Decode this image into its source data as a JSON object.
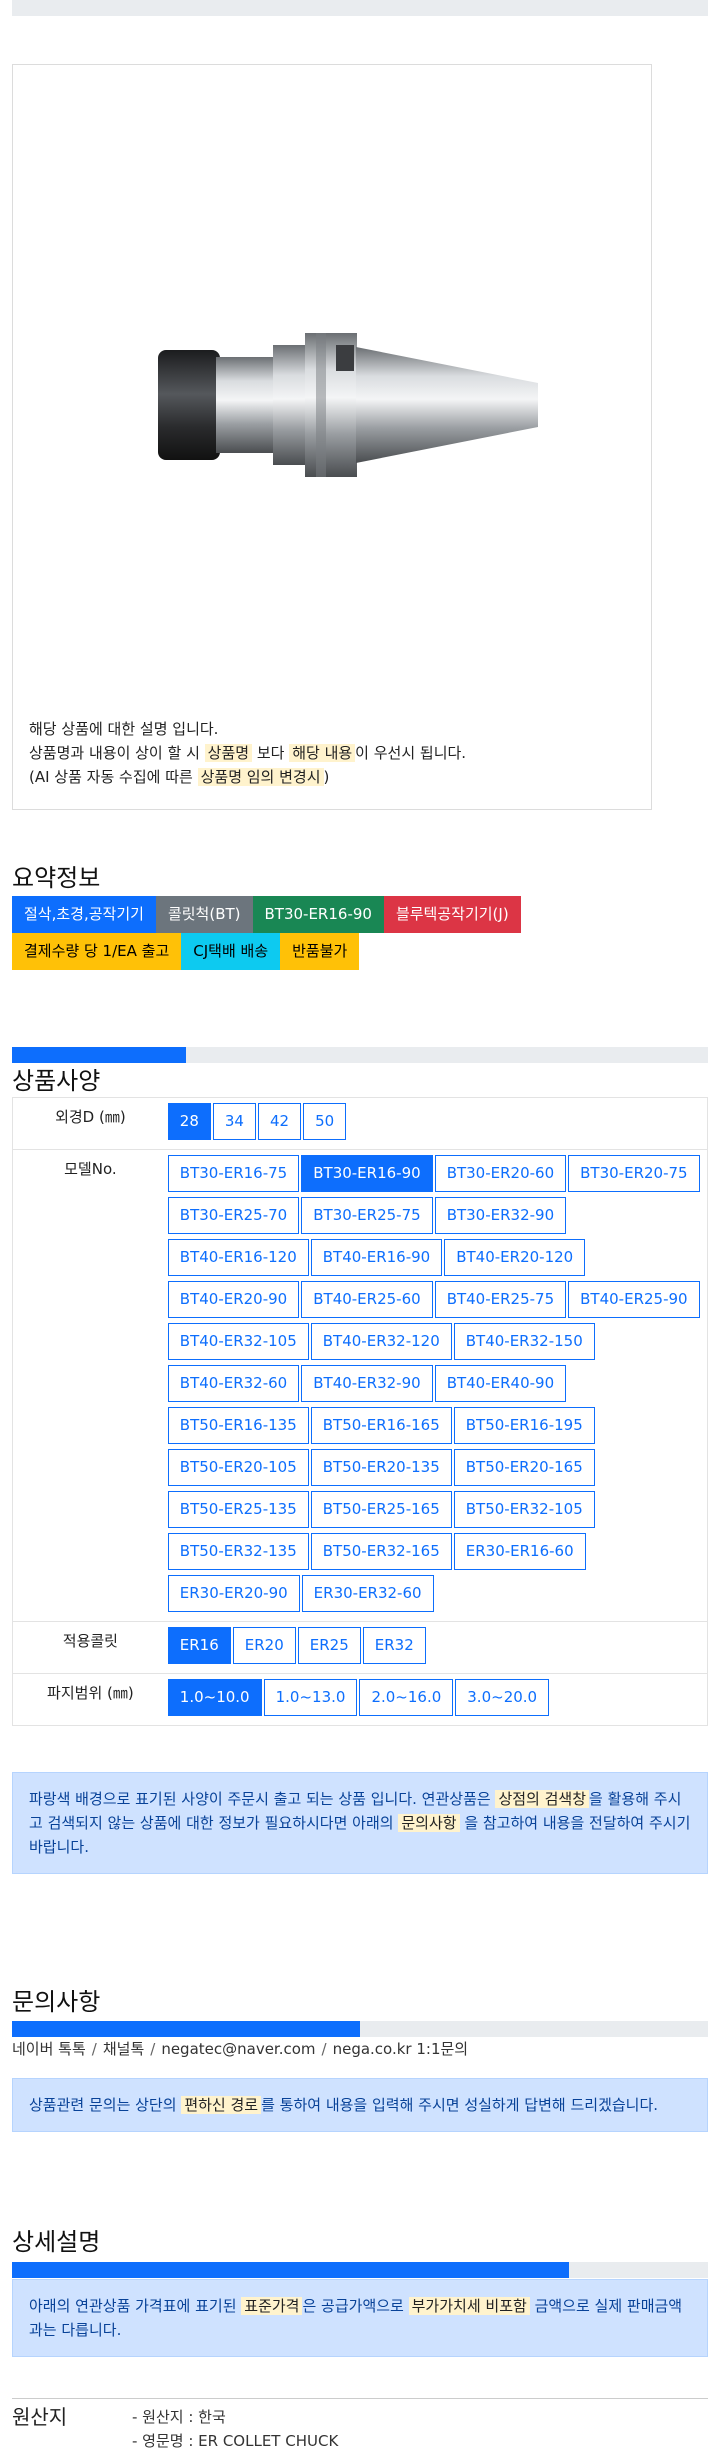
{
  "product_image": {
    "alt": "BT30 ER collet chuck"
  },
  "notice": {
    "line1": "해당 상품에 대한 설명 입니다.",
    "line2_a": "상품명과 내용이 상이 할 시 ",
    "line2_hl1": "상품명",
    "line2_b": " 보다 ",
    "line2_hl2": "해당 내용",
    "line2_c": "이 우선시 됩니다.",
    "line3_a": "(AI 상품 자동 수집에 따른 ",
    "line3_hl": "상품명 임의 변경시",
    "line3_b": ")"
  },
  "summary": {
    "title": "요약정보",
    "tags_row1": [
      {
        "label": "절삭,초경,공작기기",
        "bg": "#0d6efd",
        "fg": "#ffffff"
      },
      {
        "label": "콜릿척(BT)",
        "bg": "#6c757d",
        "fg": "#ffffff"
      },
      {
        "label": "BT30-ER16-90",
        "bg": "#198754",
        "fg": "#ffffff"
      },
      {
        "label": "블루텍공작기기(J)",
        "bg": "#dc3545",
        "fg": "#ffffff"
      }
    ],
    "tags_row2": [
      {
        "label": "결제수량 당 1/EA 출고",
        "bg": "#ffc107",
        "fg": "#000000"
      },
      {
        "label": "CJ택배 배송",
        "bg": "#0dcaf0",
        "fg": "#000000"
      },
      {
        "label": "반품불가",
        "bg": "#ffc107",
        "fg": "#000000"
      }
    ]
  },
  "spec": {
    "title": "상품사양",
    "progress": 0.25,
    "rows": [
      {
        "label": "외경D (㎜)",
        "options": [
          "28",
          "34",
          "42",
          "50"
        ],
        "selected": "28"
      },
      {
        "label": "모델No.",
        "options": [
          "BT30-ER16-75",
          "BT30-ER16-90",
          "BT30-ER20-60",
          "BT30-ER20-75",
          "BT30-ER25-70",
          "BT30-ER25-75",
          "BT30-ER32-90",
          "BT40-ER16-120",
          "BT40-ER16-90",
          "BT40-ER20-120",
          "BT40-ER20-90",
          "BT40-ER25-60",
          "BT40-ER25-75",
          "BT40-ER25-90",
          "BT40-ER32-105",
          "BT40-ER32-120",
          "BT40-ER32-150",
          "BT40-ER32-60",
          "BT40-ER32-90",
          "BT40-ER40-90",
          "BT50-ER16-135",
          "BT50-ER16-165",
          "BT50-ER16-195",
          "BT50-ER20-105",
          "BT50-ER20-135",
          "BT50-ER20-165",
          "BT50-ER25-135",
          "BT50-ER25-165",
          "BT50-ER32-105",
          "BT50-ER32-135",
          "BT50-ER32-165",
          "ER30-ER16-60",
          "ER30-ER20-90",
          "ER30-ER32-60"
        ],
        "selected": "BT30-ER16-90"
      },
      {
        "label": "적용콜릿",
        "options": [
          "ER16",
          "ER20",
          "ER25",
          "ER32"
        ],
        "selected": "ER16"
      },
      {
        "label": "파지범위 (㎜)",
        "options": [
          "1.0~10.0",
          "1.0~13.0",
          "2.0~16.0",
          "3.0~20.0"
        ],
        "selected": "1.0~10.0"
      }
    ],
    "alert": {
      "a": "파랑색 배경으로 표기된 사양이 주문시 출고 되는 상품 입니다. 연관상품은 ",
      "hl1": "상점의 검색창",
      "b": "을 활용해 주시고 검색되지 않는 상품에 대한 정보가 필요하시다면 아래의 ",
      "hl2": "문의사항",
      "c": " 을 참고하여 내용을 전달하여 주시기 바랍니다."
    }
  },
  "inquiry": {
    "title": "문의사항",
    "progress": 0.5,
    "contacts": [
      "네이버 톡톡",
      "채널톡",
      "negatec@naver.com",
      "nega.co.kr 1:1문의"
    ],
    "alert": {
      "a": "상품관련 문의는 상단의 ",
      "hl": "편하신 경로",
      "b": "를 통하여 내용을 입력해 주시면 성실하게 답변해 드리겠습니다."
    }
  },
  "detail": {
    "title": "상세설명",
    "progress": 0.8,
    "alert": {
      "a": "아래의 연관상품 가격표에 표기된 ",
      "hl1": "표준가격",
      "b": "은 공급가액으로 ",
      "hl2": "부가가치세 비포함",
      "c": " 금액으로 실제 판매금액과는 다릅니다."
    }
  },
  "origin": {
    "label": "원산지",
    "line1": "- 원산지 : 한국",
    "line2": "- 영문명 : ER COLLET CHUCK"
  }
}
